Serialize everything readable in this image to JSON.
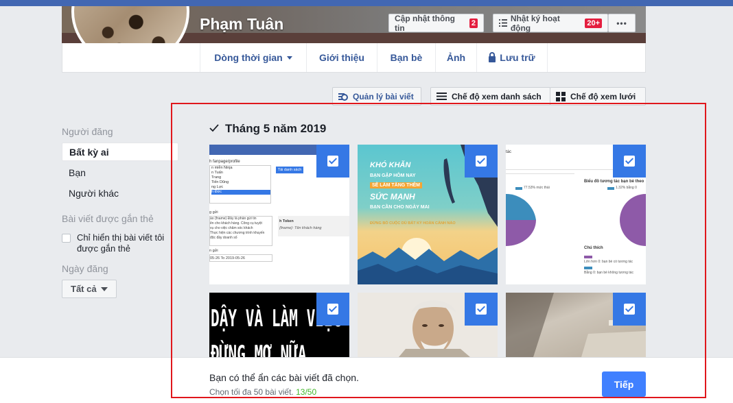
{
  "colors": {
    "facebook_blue": "#4267b2",
    "link_blue": "#365899",
    "check_blue": "#3578e5",
    "primary_button": "#4080ff",
    "badge_red": "#e41e3f",
    "count_green": "#42b72a",
    "annotation_red": "#e0161b"
  },
  "profile": {
    "name": "Phạm Tuân",
    "update_info_label": "Cập nhật thông tin",
    "update_info_badge": "2",
    "activity_log_label": "Nhật ký hoạt động",
    "activity_log_badge": "20+",
    "more_label": "•••"
  },
  "nav": {
    "timeline": "Dòng thời gian",
    "about": "Giới thiệu",
    "friends": "Bạn bè",
    "photos": "Ảnh",
    "archive": "Lưu trữ"
  },
  "toolbar": {
    "manage_posts": "Quản lý bài viết",
    "list_view": "Chế độ xem danh sách",
    "grid_view": "Chế độ xem lưới"
  },
  "filters": {
    "poster_heading": "Người đăng",
    "poster_options": [
      "Bất kỳ ai",
      "Bạn",
      "Người khác"
    ],
    "tagged_heading": "Bài viết được gắn thẻ",
    "tagged_option": "Chỉ hiển thị bài viết tôi được gắn thẻ",
    "date_heading": "Ngày đăng",
    "date_value": "Tất cả"
  },
  "section": {
    "month_title": "Tháng 5 năm 2019"
  },
  "tiles": {
    "t1": {
      "profile_label": "h fanpage/profile",
      "list_items": [
        "n miễn Ninja",
        "n Tuấn",
        "Trang",
        "Tiến Dũng",
        "ng Lực",
        "h Đức"
      ],
      "button": "Tải danh sách",
      "send_label": "g gửi",
      "token_label": "h Token",
      "token_value": "{fname}: Tên khách hàng",
      "desc": "ào {fname} Đây là phần gửi tin\nên cho khách hàng. Công cụ tuyệt\nvụ cho việc chăm sóc khách\nThực hiện các chương trình khuyến\nđộc đầy doanh số",
      "time_label": "n gửi",
      "date_range": "05-26 To 2019-05-26"
    },
    "t2": {
      "line1": "KHÓ KHĂN",
      "line2": "BẠN GẶP HÔM NAY",
      "line3": "SẼ LÀM TĂNG THÊM",
      "line4": "SỨC MẠNH",
      "line5": "BẠN CẦN CHO NGÀY MAI",
      "line6": "ĐỪNG BỎ CUỘC DÙ BẤT KỲ HOÀN CẢNH NÀO"
    },
    "t3": {
      "top": "tác",
      "chart_title": "Biểu đồ tương tác bạn bè theo",
      "left_pct": "77.53% mức thái",
      "right_pct": "1.32% bằng 0",
      "legend_title": "Chú thích",
      "legend1": "Lớn hơn 0: bạn bè có tương tác",
      "legend2": "Bằng 0: bạn bè không tương tác"
    },
    "t4": {
      "line1": "DẬY VÀ LÀM VIỆC",
      "line2": "ĐỪNG MƠ NỮA"
    }
  },
  "bottom": {
    "message": "Bạn có thể ẩn các bài viết đã chọn.",
    "limit_text": "Chọn tối đa 50 bài viết.",
    "count": "13/50",
    "next_label": "Tiếp"
  }
}
